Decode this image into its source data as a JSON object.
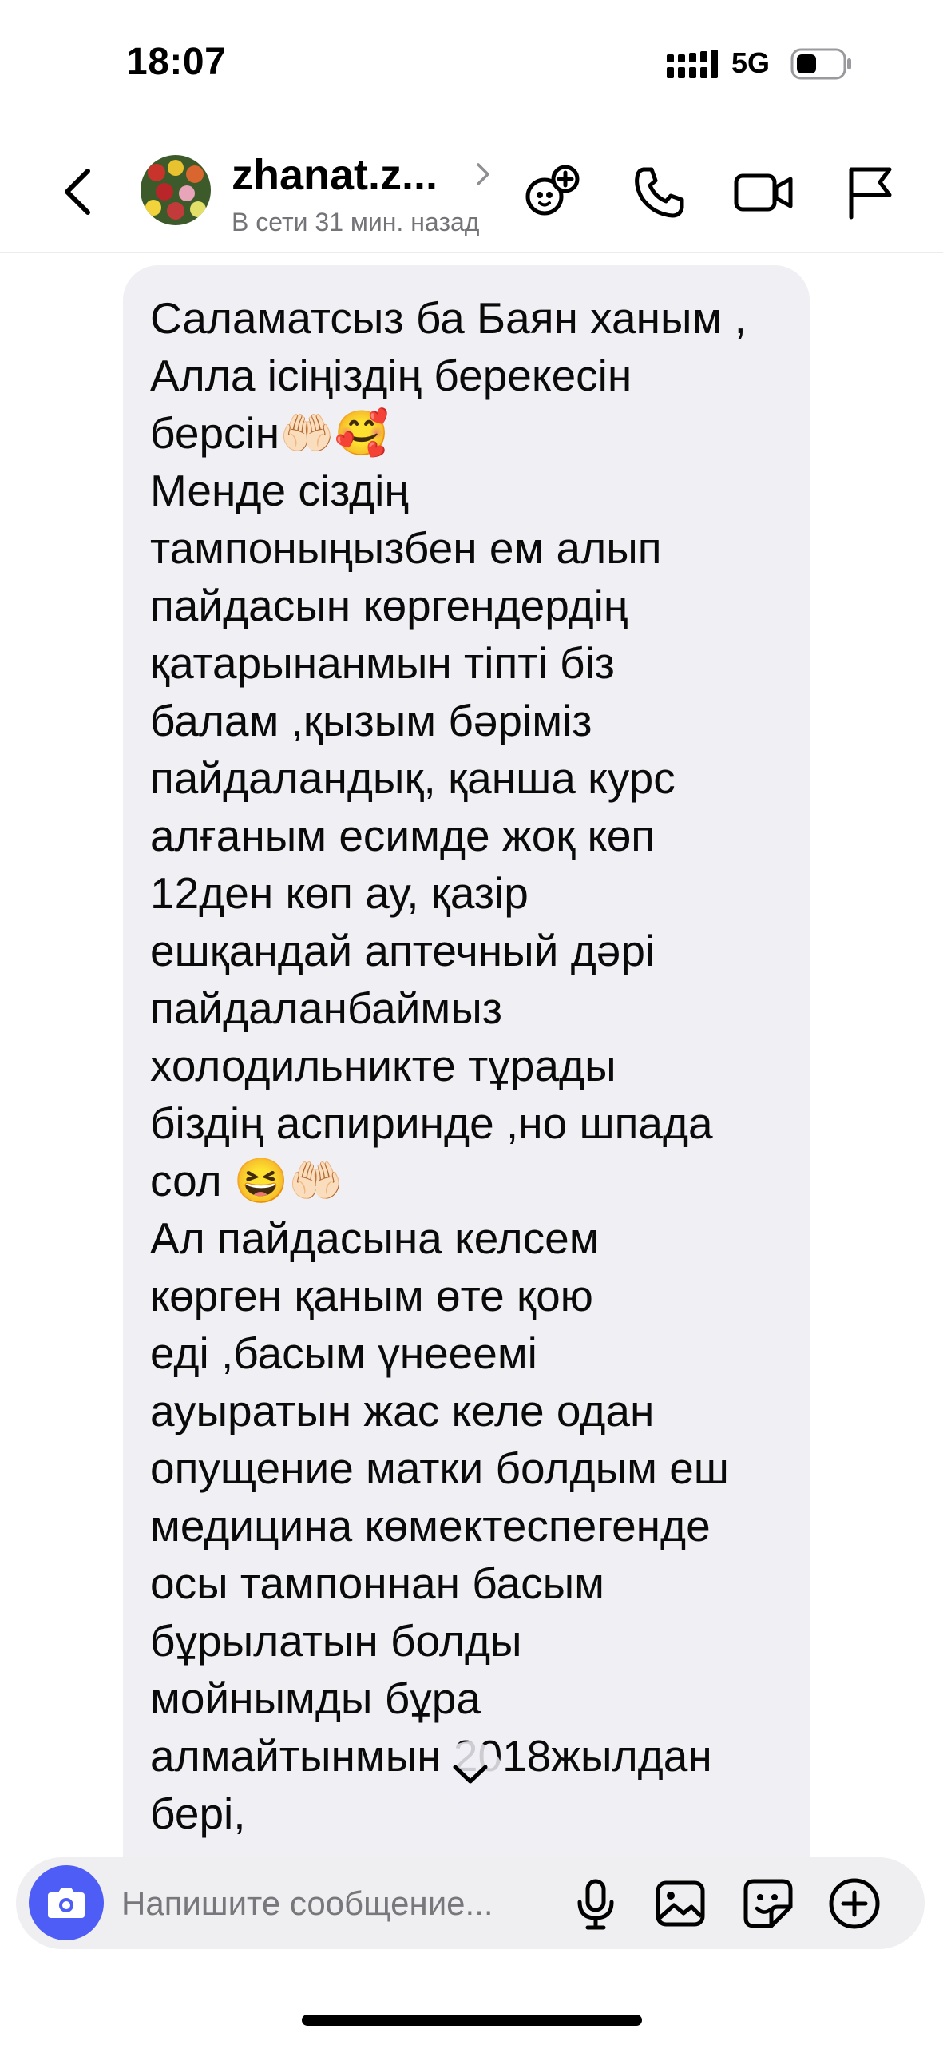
{
  "status_bar": {
    "time": "18:07",
    "network": "5G",
    "icons": [
      "signal-icon",
      "battery-icon"
    ]
  },
  "header": {
    "name": "zhanat.z...",
    "presence": "В сети 31 мин. назад",
    "icons": [
      "back-icon",
      "chevron-right-icon",
      "video-effects-icon",
      "phone-icon",
      "video-camera-icon",
      "flag-icon"
    ]
  },
  "message": {
    "text": "Саламатсыз ба Баян ханым ,\nАлла ісіңіздің берекесін\nберсін🤲🏻🥰\nМенде сіздің\nтампоныңызбен ем алып\nпайдасын көргендердің\nқатарынанмын тіпті біз\nбалам ,қызым бәріміз\nпайдаландық, қанша курс\nалғаным есимде жоқ көп\n12ден көп ау, қазір\nешқандай аптечный дәрі\nпайдаланбаймыз\nхолодильникте тұрады\nбіздің аспиринде ,но шпада\nсол 😆🤲🏻\nАл пайдасына келсем\nкөрген қаным өте қою\nеді ,басым үнееемі\nауыратын жас келе одан\nопущение матки болдым еш\nмедицина көмектеспегенде\nосы тампоннан басым\nбұрылатын болды\nмойнымды бұра\nалмайтынмын 2018жылдан\nбері,"
  },
  "composer": {
    "placeholder": "Напишите сообщение...",
    "icons": [
      "camera-icon",
      "microphone-icon",
      "gallery-icon",
      "sticker-icon",
      "add-icon"
    ]
  },
  "colors": {
    "accent": "#4d5df5",
    "bubble": "#efeff4",
    "secondary_text": "#737378"
  }
}
